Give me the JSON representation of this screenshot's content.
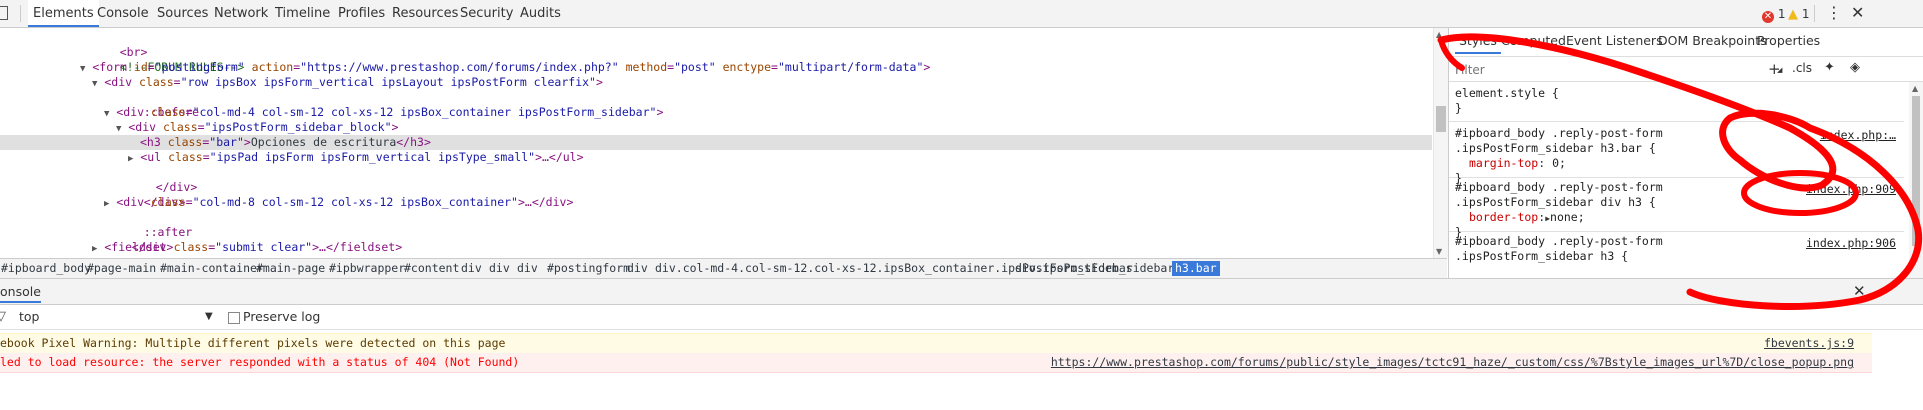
{
  "toolbar": {
    "tabs": [
      "Elements",
      "Console",
      "Sources",
      "Network",
      "Timeline",
      "Profiles",
      "Resources",
      "Security",
      "Audits"
    ],
    "error_count": "1",
    "warning_count": "1",
    "error_icon": "error-icon",
    "warning_icon": "warning-icon"
  },
  "tree": {
    "lines": {
      "br": "<br>",
      "comment": "<!--FORUM RULES-->",
      "form_tag": "<form",
      "form_id_attr": "id",
      "form_id_val": "\"postingform\"",
      "form_action_attr": "action",
      "form_action_val": "\"https://www.prestashop.com/forums/index.php?\"",
      "form_method_attr": "method",
      "form_method_val": "\"post\"",
      "form_enctype_attr": "enctype",
      "form_enctype_val": "\"multipart/form-data\"",
      "div1_tag": "<div",
      "div1_val": "\"row ipsBox ipsForm_vertical ipsLayout ipsPostForm clearfix\"",
      "before": "::before",
      "div2_val": "\"col-md-4 col-sm-12 col-xs-12 ipsBox_container ipsPostForm_sidebar\"",
      "div3_val": "\"ipsPostForm_sidebar_block\"",
      "h3_tag": "<h3",
      "h3_val": "\"bar\"",
      "h3_text": "Opciones de escritura",
      "h3_close": "</h3>",
      "ul_tag": "<ul",
      "ul_val": "\"ipsPad ipsForm ipsForm_vertical ipsType_small\"",
      "ul_close": ">…</ul>",
      "div_close": "</div>",
      "div4_val": "\"col-md-8 col-sm-12 col-xs-12 ipsBox_container\"",
      "div4_close": ">…</div>",
      "after": "::after",
      "fieldset_tag": "<fieldset",
      "fieldset_val": "\"submit clear\"",
      "fieldset_close": ">…</fieldset>",
      "class_attr": "class"
    }
  },
  "breadcrumbs": [
    "#ipboard_body",
    "#page-main",
    "#main-container",
    "#main-page",
    "#ipbwrapper",
    "#content",
    "div",
    "div",
    "div",
    "#postingform",
    "div",
    "div.col-md-4.col-sm-12.col-xs-12.ipsBox_container.ipsPostForm_sidebar",
    "div.ipsPostForm_sidebar_block",
    "h3.bar"
  ],
  "styles": {
    "tabs": [
      "Styles",
      "Computed",
      "Event Listeners",
      "DOM Breakpoints",
      "Properties"
    ],
    "filter_placeholder": "Filter",
    "cls_label": ".cls",
    "element_style": "element.style {",
    "close_brace": "}",
    "rule1_sel1": "#ipboard_body .reply-post-form",
    "rule1_sel2": ".ipsPostForm_sidebar h3.bar {",
    "rule1_prop": "margin-top",
    "rule1_val": "0;",
    "rule1_src": "index.php:…",
    "rule2_sel1": "#ipboard_body .reply-post-form",
    "rule2_sel2": ".ipsPostForm_sidebar div h3 {",
    "rule2_prop": "border-top",
    "rule2_val": "none;",
    "rule2_src": "index.php:909",
    "rule3_sel1": "#ipboard_body .reply-post-form",
    "rule3_sel2": ".ipsPostForm_sidebar h3 {",
    "rule3_src": "index.php:906"
  },
  "console": {
    "title": "onsole",
    "context": "top",
    "preserve_log": "Preserve log",
    "warn_text": "ebook Pixel Warning: Multiple different pixels were detected on this page",
    "warn_src": "fbevents.js:9",
    "err_text": "led to load resource: the server responded with a status of 404 (Not Found)",
    "err_src": "https://www.prestashop.com/forums/public/style_images/tctc91_haze/_custom/css/%7Bstyle_images_url%7D/close_popup.png"
  },
  "colors": {
    "accent": "#3879d9",
    "annotation": "#ff0000",
    "tag": "#881280",
    "attr": "#994500",
    "value": "#1a1aa6"
  }
}
